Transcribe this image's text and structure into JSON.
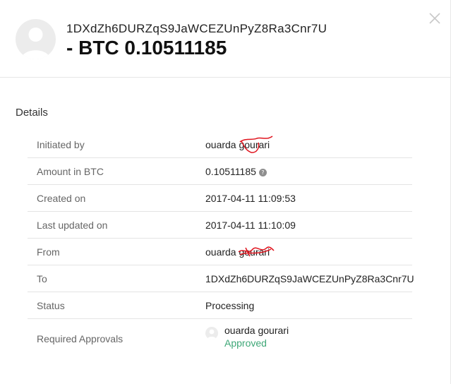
{
  "header": {
    "address": "1DXdZh6DURZqS9JaWCEZUnPyZ8Ra3Cnr7U",
    "amount": "- BTC 0.10511185"
  },
  "details": {
    "title": "Details",
    "rows": [
      {
        "label": "Initiated by",
        "value": "ouarda",
        "redacted_suffix": "gourari"
      },
      {
        "label": "Amount in BTC",
        "value": "0.10511185",
        "help_icon": "?"
      },
      {
        "label": "Created on",
        "value": "2017-04-11 11:09:53"
      },
      {
        "label": "Last updated on",
        "value": "2017-04-11 11:10:09"
      },
      {
        "label": "From",
        "value": "ouarda",
        "redacted_suffix": "gourari"
      },
      {
        "label": "To",
        "value": "1DXdZh6DURZqS9JaWCEZUnPyZ8Ra3Cnr7U"
      },
      {
        "label": "Status",
        "value": "Processing"
      },
      {
        "label": "Required Approvals",
        "approver": "ouarda gourari",
        "approval_status": "Approved"
      }
    ]
  },
  "icons": {
    "close": "close-icon",
    "avatar": "user-avatar-icon",
    "help": "question-mark-icon"
  },
  "colors": {
    "approved": "#3ea777",
    "redaction": "#e0141e"
  }
}
